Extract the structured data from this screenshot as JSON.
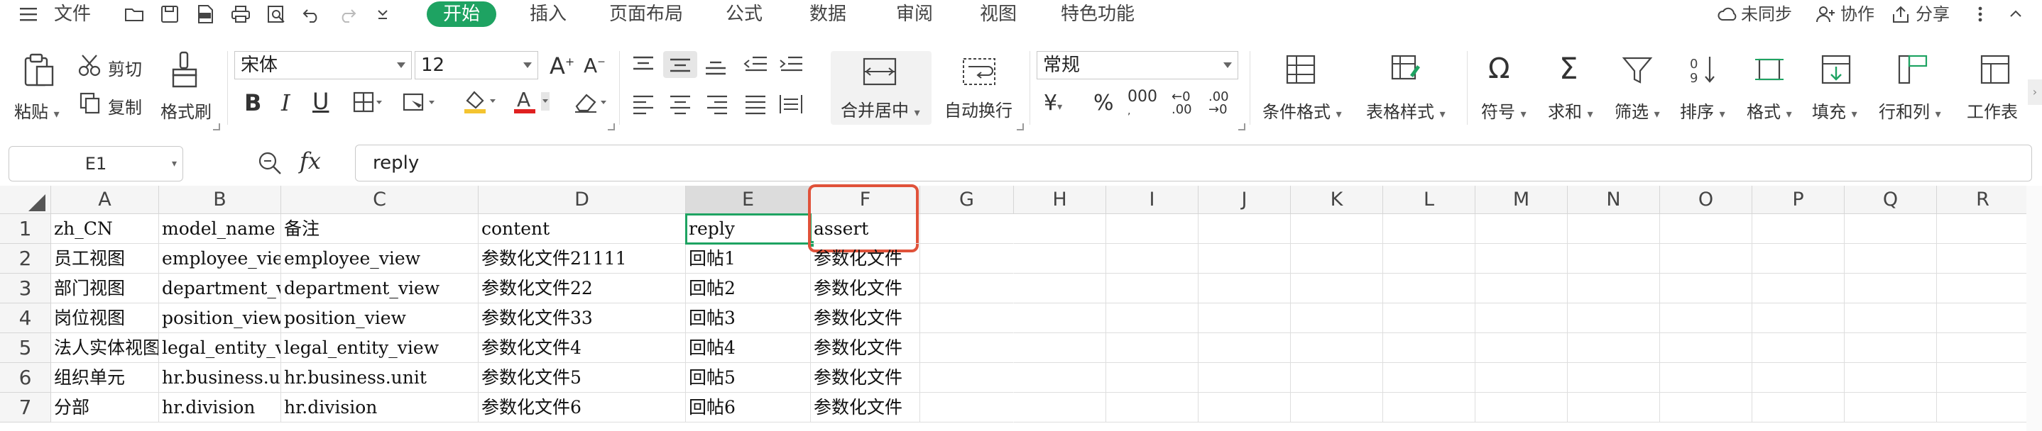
{
  "menubar": {
    "menu_label": "文件",
    "tabs": [
      "开始",
      "插入",
      "页面布局",
      "公式",
      "数据",
      "审阅",
      "视图",
      "特色功能"
    ],
    "active_tab": "开始",
    "right": {
      "sync": "未同步",
      "collab": "协作",
      "share": "分享"
    }
  },
  "ribbon": {
    "paste": "粘贴",
    "cut": "剪切",
    "copy": "复制",
    "format_painter": "格式刷",
    "font_name": "宋体",
    "font_size": "12",
    "merge_center": "合并居中",
    "wrap_text": "自动换行",
    "number_format": "常规",
    "cond_format": "条件格式",
    "table_style": "表格样式",
    "symbol": "符号",
    "sum": "求和",
    "filter": "筛选",
    "sort": "排序",
    "format": "格式",
    "fill": "填充",
    "rows_cols": "行和列",
    "worksheet": "工作表",
    "accent_color": "#1ea362"
  },
  "formula": {
    "cell_ref": "E1",
    "fx": "fx",
    "value": "reply"
  },
  "sheet": {
    "columns": [
      "A",
      "B",
      "C",
      "D",
      "E",
      "F",
      "G",
      "H",
      "I",
      "J",
      "K",
      "L",
      "M",
      "N",
      "O",
      "P",
      "Q",
      "R"
    ],
    "selected_column": "E",
    "rows": [
      {
        "num": "1",
        "cells": [
          "zh_CN",
          "model_name",
          "备注",
          "content",
          "reply",
          "assert"
        ]
      },
      {
        "num": "2",
        "cells": [
          "员工视图",
          "employee_view",
          "employee_view",
          "参数化文件21111",
          "回帖1",
          "参数化文件"
        ]
      },
      {
        "num": "3",
        "cells": [
          "部门视图",
          "department_view",
          "department_view",
          "参数化文件22",
          "回帖2",
          "参数化文件"
        ]
      },
      {
        "num": "4",
        "cells": [
          "岗位视图",
          "position_view",
          "position_view",
          "参数化文件33",
          "回帖3",
          "参数化文件"
        ]
      },
      {
        "num": "5",
        "cells": [
          "法人实体视图",
          "legal_entity_view",
          "legal_entity_view",
          "参数化文件4",
          "回帖4",
          "参数化文件"
        ]
      },
      {
        "num": "6",
        "cells": [
          "组织单元",
          "hr.business.unit",
          "hr.business.unit",
          "参数化文件5",
          "回帖5",
          "参数化文件"
        ]
      },
      {
        "num": "7",
        "cells": [
          "分部",
          "hr.division",
          "hr.division",
          "参数化文件6",
          "回帖6",
          "参数化文件"
        ]
      }
    ]
  }
}
